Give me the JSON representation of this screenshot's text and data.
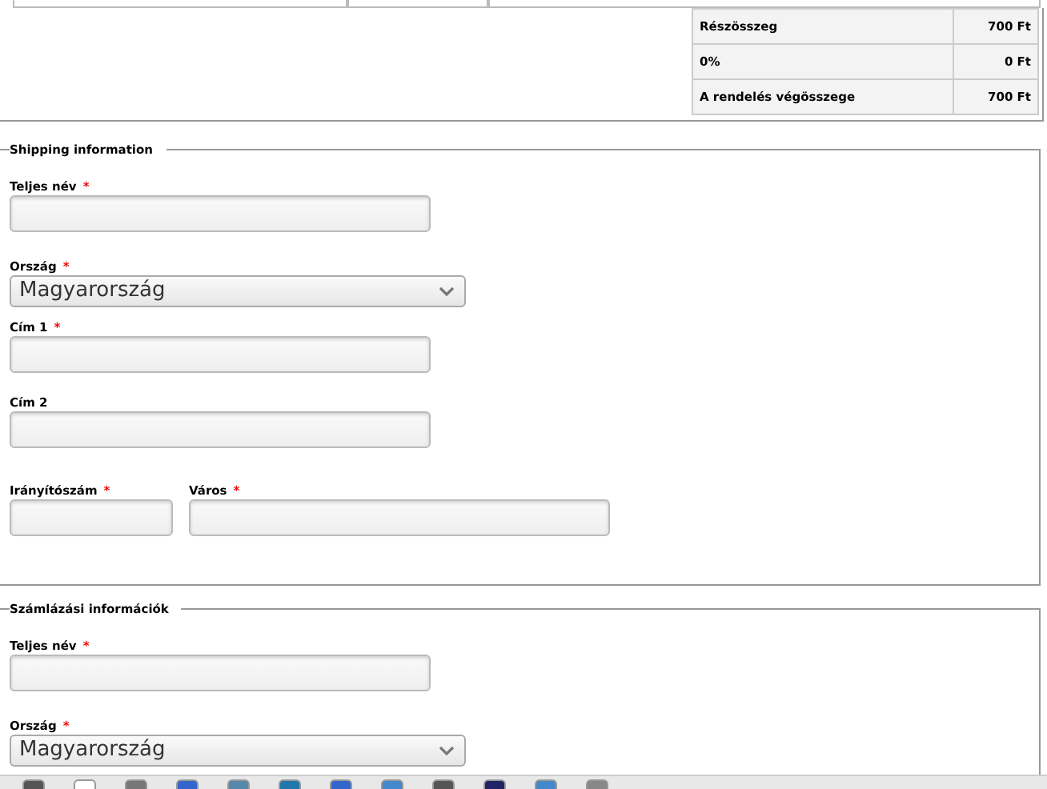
{
  "totals": [
    {
      "label": "Részösszeg",
      "value": "700 Ft"
    },
    {
      "label": "0%",
      "value": "0 Ft"
    },
    {
      "label": "A rendelés végösszege",
      "value": "700 Ft"
    }
  ],
  "sections": [
    {
      "legend": "Shipping information",
      "rows": [
        [
          {
            "kind": "text",
            "label": "Teljes név",
            "required_mark": "*"
          }
        ],
        [
          {
            "kind": "select",
            "label": "Ország",
            "required_mark": "*",
            "value": "Magyarország"
          }
        ],
        [
          {
            "kind": "text",
            "label": "Cím 1",
            "required_mark": "*"
          }
        ],
        [
          {
            "kind": "text",
            "label": "Cím 2"
          }
        ],
        [
          {
            "kind": "text",
            "label": "Irányítószám",
            "required_mark": "*"
          },
          {
            "kind": "text",
            "label": "Város",
            "required_mark": "*"
          }
        ]
      ]
    },
    {
      "legend": "Számlázási információk",
      "rows": [
        [
          {
            "kind": "text",
            "label": "Teljes név",
            "required_mark": "*"
          }
        ],
        [
          {
            "kind": "select",
            "label": "Ország",
            "required_mark": "*",
            "value": "Magyarország"
          }
        ]
      ]
    }
  ]
}
